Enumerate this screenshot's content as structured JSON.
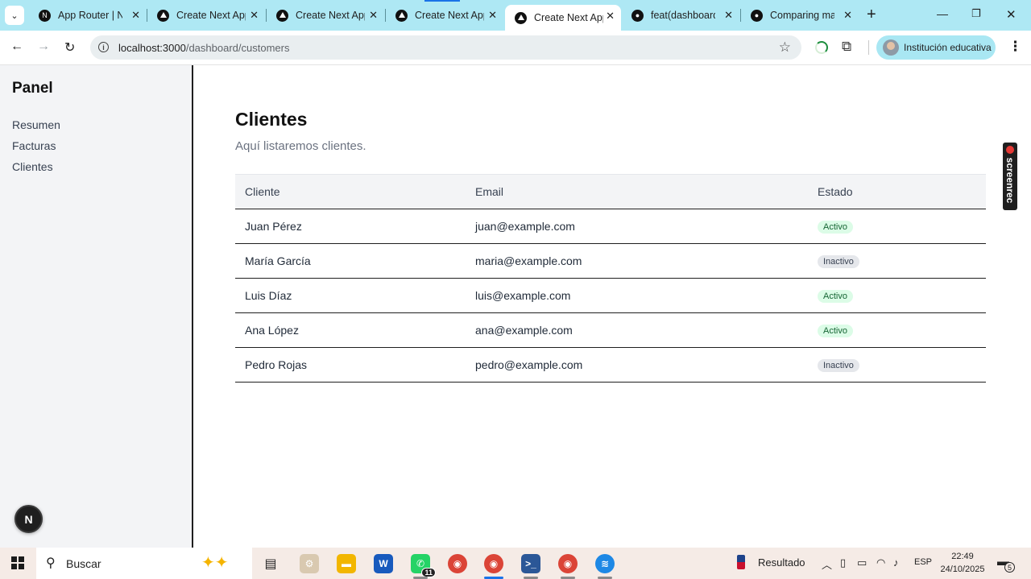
{
  "browser": {
    "tabs": [
      {
        "title": "App Router | Next.js",
        "icon": "nextjs-icon",
        "active": false
      },
      {
        "title": "Create Next App",
        "icon": "vercel-triangle-icon",
        "active": false
      },
      {
        "title": "Create Next App",
        "icon": "vercel-triangle-icon",
        "active": false
      },
      {
        "title": "Create Next App",
        "icon": "vercel-triangle-icon",
        "active": false
      },
      {
        "title": "Create Next App",
        "icon": "vercel-triangle-icon",
        "active": true
      },
      {
        "title": "feat(dashboard):",
        "icon": "github-icon",
        "active": false
      },
      {
        "title": "Comparing main",
        "icon": "github-icon",
        "active": false
      }
    ],
    "url_host": "localhost:3000",
    "url_path": "/dashboard/customers",
    "profile_label": "Institución educativa"
  },
  "sidebar": {
    "brand": "Panel",
    "links": [
      "Resumen",
      "Facturas",
      "Clientes"
    ],
    "dev_badge": "N"
  },
  "page": {
    "title": "Clientes",
    "subtitle": "Aquí listaremos clientes.",
    "table": {
      "headers": [
        "Cliente",
        "Email",
        "Estado"
      ],
      "rows": [
        {
          "name": "Juan Pérez",
          "email": "juan@example.com",
          "status": "Activo",
          "active": true
        },
        {
          "name": "María García",
          "email": "maria@example.com",
          "status": "Inactivo",
          "active": false
        },
        {
          "name": "Luis Díaz",
          "email": "luis@example.com",
          "status": "Activo",
          "active": true
        },
        {
          "name": "Ana López",
          "email": "ana@example.com",
          "status": "Activo",
          "active": true
        },
        {
          "name": "Pedro Rojas",
          "email": "pedro@example.com",
          "status": "Inactivo",
          "active": false
        }
      ]
    }
  },
  "overlay": {
    "screenrec": "screenrec"
  },
  "taskbar": {
    "search_placeholder": "Buscar",
    "whatsapp_count": "11",
    "news_label": "Resultado",
    "language": "ESP",
    "time": "22:49",
    "date": "24/10/2025",
    "notification_count": "5"
  },
  "colors": {
    "tabstrip_bg": "#aee8f4",
    "sidebar_bg": "#f3f4f6",
    "badge_active_bg": "#dcfce7",
    "badge_active_text": "#166534",
    "badge_inactive_bg": "#e5e7eb",
    "taskbar_bg": "#f5ebe6"
  }
}
